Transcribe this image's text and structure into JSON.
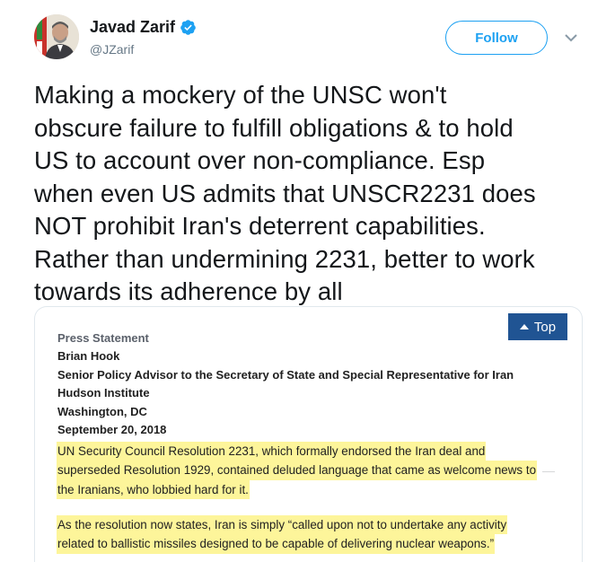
{
  "author": {
    "name": "Javad Zarif",
    "handle": "@JZarif",
    "verified_icon": "verified-badge-icon",
    "verified_color": "#1da1f2"
  },
  "actions": {
    "follow_label": "Follow",
    "more_icon": "chevron-down-icon"
  },
  "tweet": {
    "lines": [
      "Making a mockery of the UNSC won't",
      "obscure failure to fulfill obligations & to hold",
      "US to account over non-compliance. Esp",
      "when even US admits that UNSCR2231 does",
      "NOT prohibit Iran's deterrent capabilities.",
      "Rather than undermining 2231, better to work",
      "towards its adherence by all"
    ]
  },
  "attached_image": {
    "top_button_label": "Top",
    "top_button_color": "#205493",
    "statement_type": "Press Statement",
    "speaker": "Brian Hook",
    "speaker_title": "Senior Policy Advisor to the Secretary of State and Special Representative for Iran",
    "venue": "Hudson Institute",
    "location": "Washington, DC",
    "date": "September 20, 2018",
    "highlight_color": "#fdf59a",
    "paragraph1": [
      "UN Security Council Resolution 2231, which formally endorsed the Iran deal and",
      "superseded Resolution 1929, contained deluded language that came as welcome news to",
      "the Iranians, who lobbied hard for it."
    ],
    "paragraph2": [
      "As the resolution now states, Iran is simply “called upon not to undertake any activity",
      "related to ballistic missiles designed to be capable of delivering nuclear weapons.”"
    ]
  }
}
